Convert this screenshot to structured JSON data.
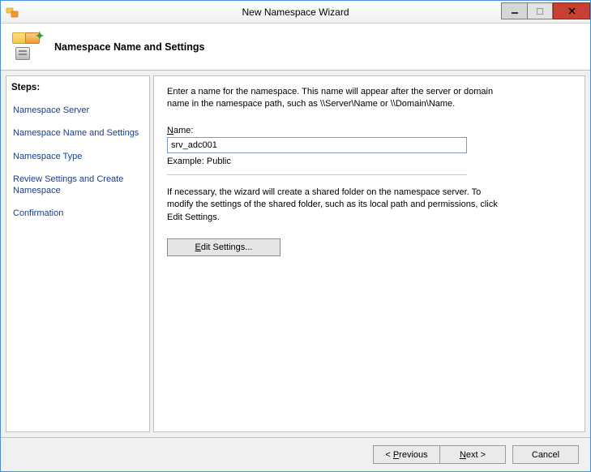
{
  "window": {
    "title": "New Namespace Wizard"
  },
  "header": {
    "title": "Namespace Name and Settings"
  },
  "sidebar": {
    "label": "Steps:",
    "items": [
      {
        "label": "Namespace Server"
      },
      {
        "label": "Namespace Name and Settings"
      },
      {
        "label": "Namespace Type"
      },
      {
        "label": "Review Settings and Create Namespace"
      },
      {
        "label": "Confirmation"
      }
    ]
  },
  "content": {
    "description": "Enter a name for the namespace. This name will appear after the server or domain name in the namespace path, such as \\\\Server\\Name or \\\\Domain\\Name.",
    "name_label": "Name:",
    "name_value": "srv_adc001",
    "example": "Example: Public",
    "description2": "If necessary, the wizard will create a shared folder on the namespace server. To modify the settings of the shared folder, such as its local path and permissions, click Edit Settings.",
    "edit_button": "Edit Settings..."
  },
  "footer": {
    "previous": "< Previous",
    "next": "Next >",
    "cancel": "Cancel"
  }
}
